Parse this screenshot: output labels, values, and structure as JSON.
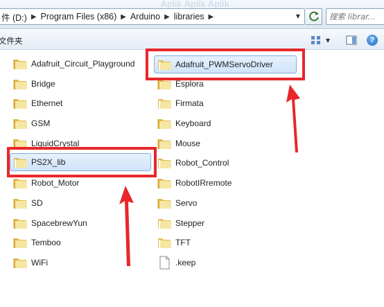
{
  "address_bar": {
    "background_title": "Aplik Aplik Aplik",
    "crumbs": [
      "件 (D:)",
      "Program Files (x86)",
      "Arduino",
      "libraries"
    ]
  },
  "search": {
    "placeholder": "搜索 librar..."
  },
  "toolbar": {
    "label": "文件夹"
  },
  "files": {
    "left": [
      "Adafruit_Circuit_Playground",
      "Bridge",
      "Ethernet",
      "GSM",
      "LiquidCrystal",
      "PS2X_lib",
      "Robot_Motor",
      "SD",
      "SpacebrewYun",
      "Temboo",
      "WiFi"
    ],
    "right": [
      "Adafruit_PWMServoDriver",
      "Esplora",
      "Firmata",
      "Keyboard",
      "Mouse",
      "Robot_Control",
      "RobotIRremote",
      "Servo",
      "Stepper",
      "TFT",
      ".keep"
    ]
  },
  "colors": {
    "highlight": "#e8262b",
    "selection_border": "#84acdd",
    "folder_light": "#f6e6a4",
    "folder_dark": "#e4b94d"
  }
}
